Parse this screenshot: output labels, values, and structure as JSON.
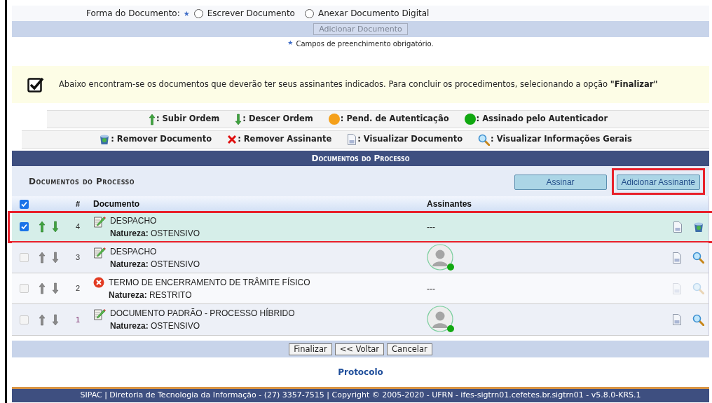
{
  "form": {
    "label": "Forma do Documento:",
    "required_mark": "★",
    "options": [
      {
        "label": "Escrever Documento",
        "selected": false
      },
      {
        "label": "Anexar Documento Digital",
        "selected": false
      }
    ],
    "add_button": {
      "label": "Adicionar Documento",
      "disabled": true
    },
    "required_note": "Campos de preenchimento obrigatório.",
    "required_note_mark": "★"
  },
  "notice": {
    "text": "Abaixo encontram-se os documentos que deverão ter seus assinantes indicados. Para concluir os procedimentos, selecionando a opção **\"Finalizar\"**"
  },
  "legend_rows": [
    [
      {
        "kind": "up",
        "label": ": Subir Ordem"
      },
      {
        "kind": "down",
        "label": ": Descer Ordem"
      },
      {
        "kind": "dot",
        "color": "#f5a01a",
        "label": ": Pend. de Autenticação"
      },
      {
        "kind": "dot",
        "color": "#11a811",
        "label": ": Assinado pelo Autenticador"
      }
    ],
    [
      {
        "kind": "trash",
        "label": ": Remover Documento"
      },
      {
        "kind": "x",
        "label": ": Remover Assinante"
      },
      {
        "kind": "doc",
        "label": ": Visualizar Documento"
      },
      {
        "kind": "search",
        "label": ": Visualizar Informações Gerais"
      }
    ]
  ],
  "panel": {
    "title": "Documentos do Processo",
    "subtitle": "Documentos do Processo",
    "buttons": [
      {
        "label": "Assinar",
        "highlighted": false
      },
      {
        "label": "Adicionar Assinante",
        "highlighted": true
      }
    ],
    "columns": [
      {
        "kind": "check",
        "checked": true
      },
      {
        "kind": "text",
        "label": "#"
      },
      {
        "kind": "text",
        "label": "Documento"
      },
      {
        "kind": "text",
        "label": "Assinantes"
      }
    ],
    "rows": [
      {
        "checked": true,
        "highlighted": true,
        "number": "4",
        "kind": "edit",
        "title": "DESPACHO",
        "nature_label": "Natureza:",
        "nature": "OSTENSIVO",
        "signer": {
          "kind": "text",
          "text": "---"
        },
        "actions": [
          {
            "kind": "doc",
            "disabled": false
          },
          {
            "kind": "trash",
            "disabled": false
          }
        ]
      },
      {
        "checked": false,
        "highlighted": false,
        "number": "3",
        "kind": "edit",
        "title": "DESPACHO",
        "nature_label": "Natureza:",
        "nature": "OSTENSIVO",
        "signer": {
          "kind": "avatar",
          "color": "#11a811"
        },
        "actions": [
          {
            "kind": "doc",
            "disabled": false
          },
          {
            "kind": "search",
            "disabled": false
          }
        ]
      },
      {
        "checked": false,
        "highlighted": false,
        "number": "2",
        "kind": "error",
        "title": "TERMO DE ENCERRAMENTO DE TRÂMITE FÍSICO",
        "nature_label": "Natureza:",
        "nature": "RESTRITO",
        "signer": {
          "kind": "text",
          "text": "---"
        },
        "actions": [
          {
            "kind": "doc",
            "disabled": true
          },
          {
            "kind": "search",
            "disabled": true
          }
        ]
      },
      {
        "checked": false,
        "highlighted": false,
        "number": "1",
        "kind": "edit",
        "title": "DOCUMENTO PADRÃO - PROCESSO HÍBRIDO",
        "nature_label": "Natureza:",
        "nature": "OSTENSIVO",
        "signer": {
          "kind": "avatar",
          "color": "#11a811"
        },
        "actions": [
          {
            "kind": "doc",
            "disabled": false
          },
          {
            "kind": "search",
            "disabled": false
          }
        ]
      }
    ]
  },
  "footer_buttons": [
    "Finalizar",
    "<< Voltar",
    "Cancelar"
  ],
  "module_link": "Protocolo",
  "status_bar": "SIPAC | Diretoria de Tecnologia da Informação - (27) 3357-7515 | Copyright © 2005-2020 - UFRN - ifes-sigtrn01.cefetes.br.sigtrn01 - v5.8.0-KRS.1"
}
